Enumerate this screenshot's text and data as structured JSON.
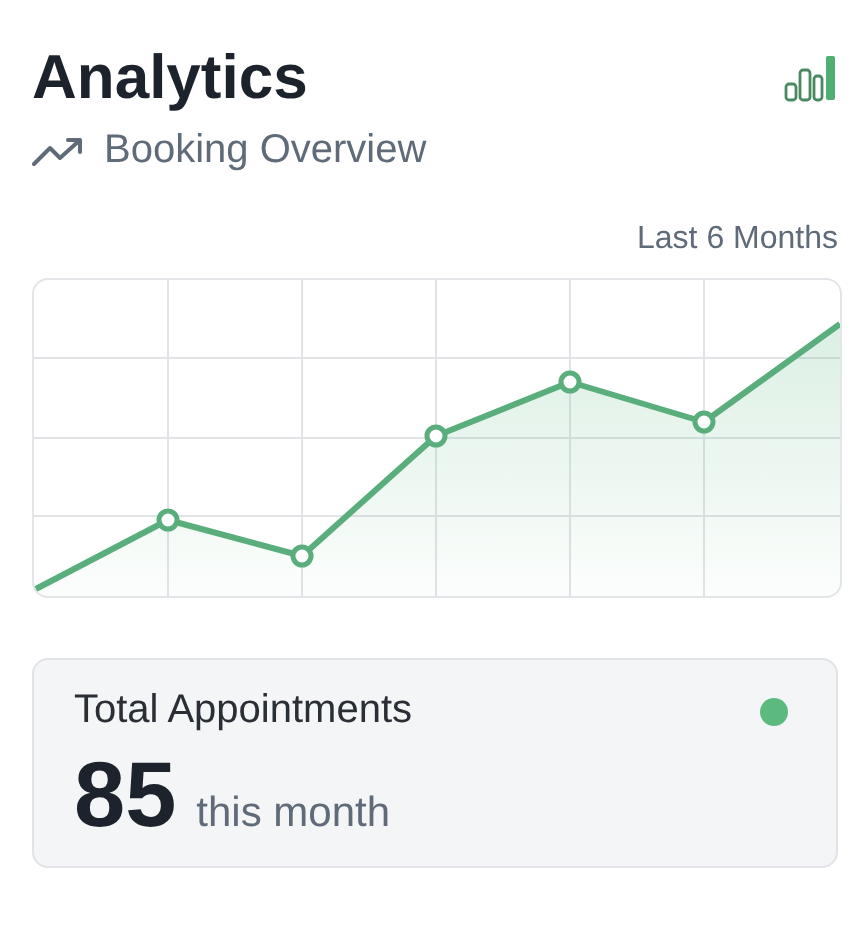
{
  "header": {
    "title": "Analytics",
    "subtitle": "Booking Overview"
  },
  "chart": {
    "range_label": "Last 6 Months"
  },
  "stat_card": {
    "label": "Total Appointments",
    "value": "85",
    "unit": "this month"
  }
}
